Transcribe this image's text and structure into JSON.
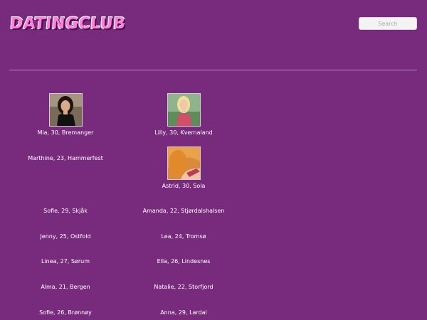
{
  "header": {
    "logo_text": "DATINGCLUB",
    "search_placeholder": "Search"
  },
  "profiles": [
    {
      "label": "Mia, 30, Bremanger",
      "photo": "woman-dark-hair-photo"
    },
    {
      "label": "Lilly, 30, Kvernaland",
      "photo": "woman-blonde-photo"
    },
    {
      "label": "Marthine, 23, Hammerfest"
    },
    {
      "label": "Astrid, 30, Sola",
      "photo": "woman-orange-hair-photo"
    },
    {
      "label": "Sofie, 29, Skjåk"
    },
    {
      "label": "Amanda, 22, Stjørdalshalsen"
    },
    {
      "label": "Jenny, 25, Ostfold"
    },
    {
      "label": "Lea, 24, Tromsø"
    },
    {
      "label": "Linea, 27, Sørum"
    },
    {
      "label": "Ella, 26, Lindesnes"
    },
    {
      "label": "Alma, 21, Bergen"
    },
    {
      "label": "Natalie, 22, Storfjord"
    },
    {
      "label": "Sofie, 26, Brønnøy"
    },
    {
      "label": "Anna, 29, Lardal"
    }
  ],
  "colors": {
    "background": "#782a7c",
    "logo_fill": "#ff7fd9",
    "divider": "#b388b6"
  }
}
